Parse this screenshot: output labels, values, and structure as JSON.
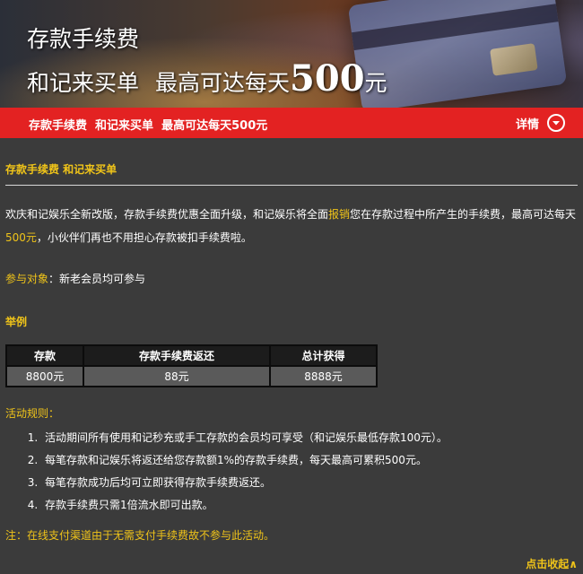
{
  "banner": {
    "line1": "存款手续费",
    "line2_prefix": "和记来买单",
    "line2_mid": "最高可达每天",
    "line2_amount": "500",
    "line2_unit": "元"
  },
  "header_bar": {
    "title": "存款手续费  和记来买单  最高可达每天500元",
    "details_label": "详情",
    "details_icon": "chevron-down-circle-icon"
  },
  "content": {
    "section_title": "存款手续费 和记来买单",
    "intro_parts": [
      "欢庆和记娱乐全新改版，存款手续费优惠全面升级，和记娱乐将全面",
      "报销",
      "您在存款过程中所产生的手续费，最高可达每天",
      "500元",
      "，小伙伴们再也不用担心存款被扣手续费啦。"
    ],
    "participants_label": "参与对象",
    "participants_sep": "：",
    "participants_value": "新老会员均可参与",
    "example_title": "举例",
    "table": {
      "headers": [
        "存款",
        "存款手续费返还",
        "总计获得"
      ],
      "rows": [
        [
          "8800元",
          "88元",
          "8888元"
        ]
      ]
    },
    "rules_title": "活动规则：",
    "rules": [
      "活动期间所有使用和记秒充或手工存款的会员均可享受（和记娱乐最低存款100元）。",
      "每笔存款和记娱乐将返还给您存款额1%的存款手续费，每天最高可累积500元。",
      "每笔存款成功后均可立即获得存款手续费返还。",
      "存款手续费只需1倍流水即可出款。"
    ],
    "note": "注：在线支付渠道由于无需支付手续费故不参与此活动。",
    "collapse_label": "点击收起∧"
  },
  "colors": {
    "background": "#3b3b3b",
    "accent_red": "#e32222",
    "highlight_yellow": "#f0c419"
  }
}
